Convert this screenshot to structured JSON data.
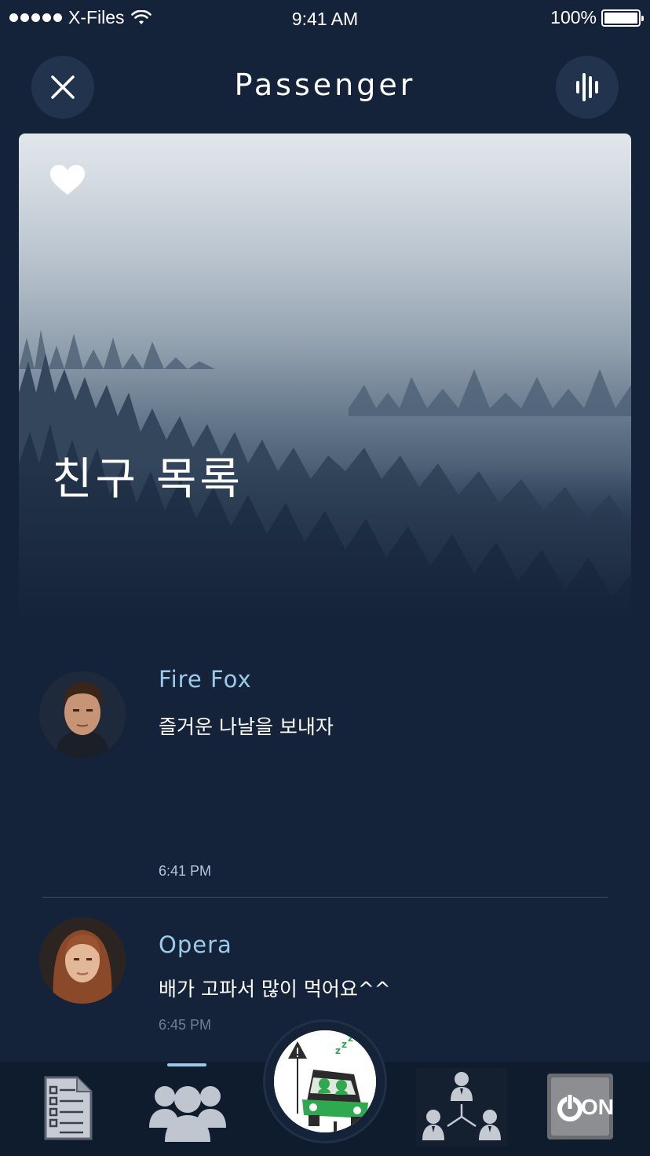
{
  "status_bar": {
    "carrier": "X-Files",
    "time": "9:41 AM",
    "battery": "100%"
  },
  "header": {
    "title": "Passenger",
    "close_icon": "close-icon",
    "menu_icon": "equalizer-icon"
  },
  "hero": {
    "title": "친구 목록",
    "favorite_icon": "heart-icon"
  },
  "messages": [
    {
      "name": "Fire Fox",
      "text": "즐거운 나날을 보내자",
      "time": "6:41 PM"
    },
    {
      "name": "Opera",
      "text": "배가 고파서 많이 먹어요^^",
      "time": "6:45 PM"
    }
  ],
  "tab_bar": {
    "tabs": [
      {
        "icon": "checklist-icon",
        "active": false
      },
      {
        "icon": "friends-icon",
        "active": true
      },
      {
        "icon": "drowsy-car-icon",
        "active": false
      },
      {
        "icon": "org-chart-icon",
        "active": false
      },
      {
        "icon": "power-on-icon",
        "active": false
      }
    ],
    "power_label": "ON"
  },
  "colors": {
    "background": "#15233a",
    "accent": "#9ccbe9",
    "tab_bar": "#0f1c2e",
    "button_bg": "#22344d",
    "car_green": "#2fa84f"
  }
}
